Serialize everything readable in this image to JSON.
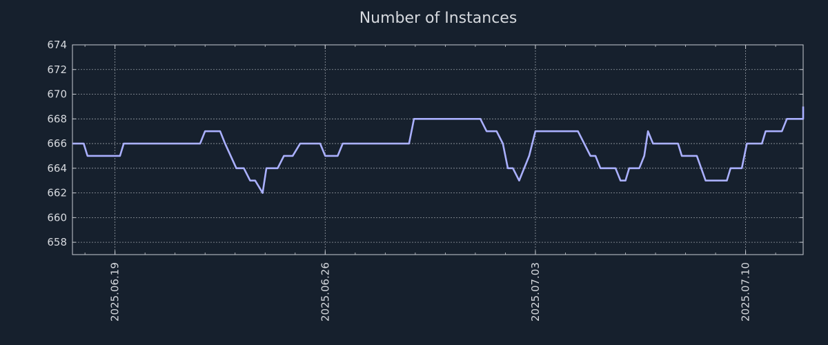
{
  "chart_data": {
    "type": "line",
    "title": "Number of Instances",
    "xlabel": "",
    "ylabel": "",
    "x_range": [
      "2025-06-17T14:00",
      "2025-07-11T22:00"
    ],
    "ylim": [
      657,
      674
    ],
    "yticks": [
      658,
      660,
      662,
      664,
      666,
      668,
      670,
      672,
      674
    ],
    "xticks": [
      "2025-06-19",
      "2025-06-26",
      "2025-07-03",
      "2025-07-10"
    ],
    "xtick_labels": [
      "2025.06.19",
      "2025.06.26",
      "2025.07.03",
      "2025.07.10"
    ],
    "grid": true,
    "line_color": "#aab0ff",
    "series": [
      {
        "points": [
          [
            "2025-06-17T14:00",
            666
          ],
          [
            "2025-06-17T23:00",
            666
          ],
          [
            "2025-06-18T02:00",
            665
          ],
          [
            "2025-06-19T04:00",
            665
          ],
          [
            "2025-06-19T07:00",
            666
          ],
          [
            "2025-06-21T20:00",
            666
          ],
          [
            "2025-06-22T00:00",
            667
          ],
          [
            "2025-06-22T12:00",
            667
          ],
          [
            "2025-06-22T16:00",
            666
          ],
          [
            "2025-06-23T01:00",
            664
          ],
          [
            "2025-06-23T07:00",
            664
          ],
          [
            "2025-06-23T12:00",
            663
          ],
          [
            "2025-06-23T16:00",
            663
          ],
          [
            "2025-06-23T22:00",
            662
          ],
          [
            "2025-06-24T01:00",
            664
          ],
          [
            "2025-06-24T10:00",
            664
          ],
          [
            "2025-06-24T15:00",
            665
          ],
          [
            "2025-06-24T22:00",
            665
          ],
          [
            "2025-06-25T04:00",
            666
          ],
          [
            "2025-06-25T20:00",
            666
          ],
          [
            "2025-06-26T00:00",
            665
          ],
          [
            "2025-06-26T10:00",
            665
          ],
          [
            "2025-06-26T14:00",
            666
          ],
          [
            "2025-06-28T19:00",
            666
          ],
          [
            "2025-06-28T23:00",
            668
          ],
          [
            "2025-07-01T04:00",
            668
          ],
          [
            "2025-07-01T09:00",
            667
          ],
          [
            "2025-07-01T17:00",
            667
          ],
          [
            "2025-07-01T22:00",
            666
          ],
          [
            "2025-07-02T02:00",
            664
          ],
          [
            "2025-07-02T06:00",
            664
          ],
          [
            "2025-07-02T11:00",
            663
          ],
          [
            "2025-07-02T19:00",
            665
          ],
          [
            "2025-07-03T00:00",
            667
          ],
          [
            "2025-07-04T10:00",
            667
          ],
          [
            "2025-07-04T20:00",
            665
          ],
          [
            "2025-07-05T00:00",
            665
          ],
          [
            "2025-07-05T04:00",
            664
          ],
          [
            "2025-07-05T16:00",
            664
          ],
          [
            "2025-07-05T20:00",
            663
          ],
          [
            "2025-07-06T00:00",
            663
          ],
          [
            "2025-07-06T03:00",
            664
          ],
          [
            "2025-07-06T11:00",
            664
          ],
          [
            "2025-07-06T15:00",
            665
          ],
          [
            "2025-07-06T18:00",
            667
          ],
          [
            "2025-07-06T22:00",
            666
          ],
          [
            "2025-07-07T18:00",
            666
          ],
          [
            "2025-07-07T21:00",
            665
          ],
          [
            "2025-07-08T09:00",
            665
          ],
          [
            "2025-07-08T16:00",
            663
          ],
          [
            "2025-07-09T09:00",
            663
          ],
          [
            "2025-07-09T12:00",
            664
          ],
          [
            "2025-07-09T21:00",
            664
          ],
          [
            "2025-07-10T01:00",
            666
          ],
          [
            "2025-07-10T13:00",
            666
          ],
          [
            "2025-07-10T16:00",
            667
          ],
          [
            "2025-07-11T05:00",
            667
          ],
          [
            "2025-07-11T09:00",
            668
          ],
          [
            "2025-07-12T02:00",
            668
          ],
          [
            "2025-07-12T06:00",
            669
          ],
          [
            "2025-07-12T22:00",
            669
          ]
        ]
      }
    ]
  }
}
